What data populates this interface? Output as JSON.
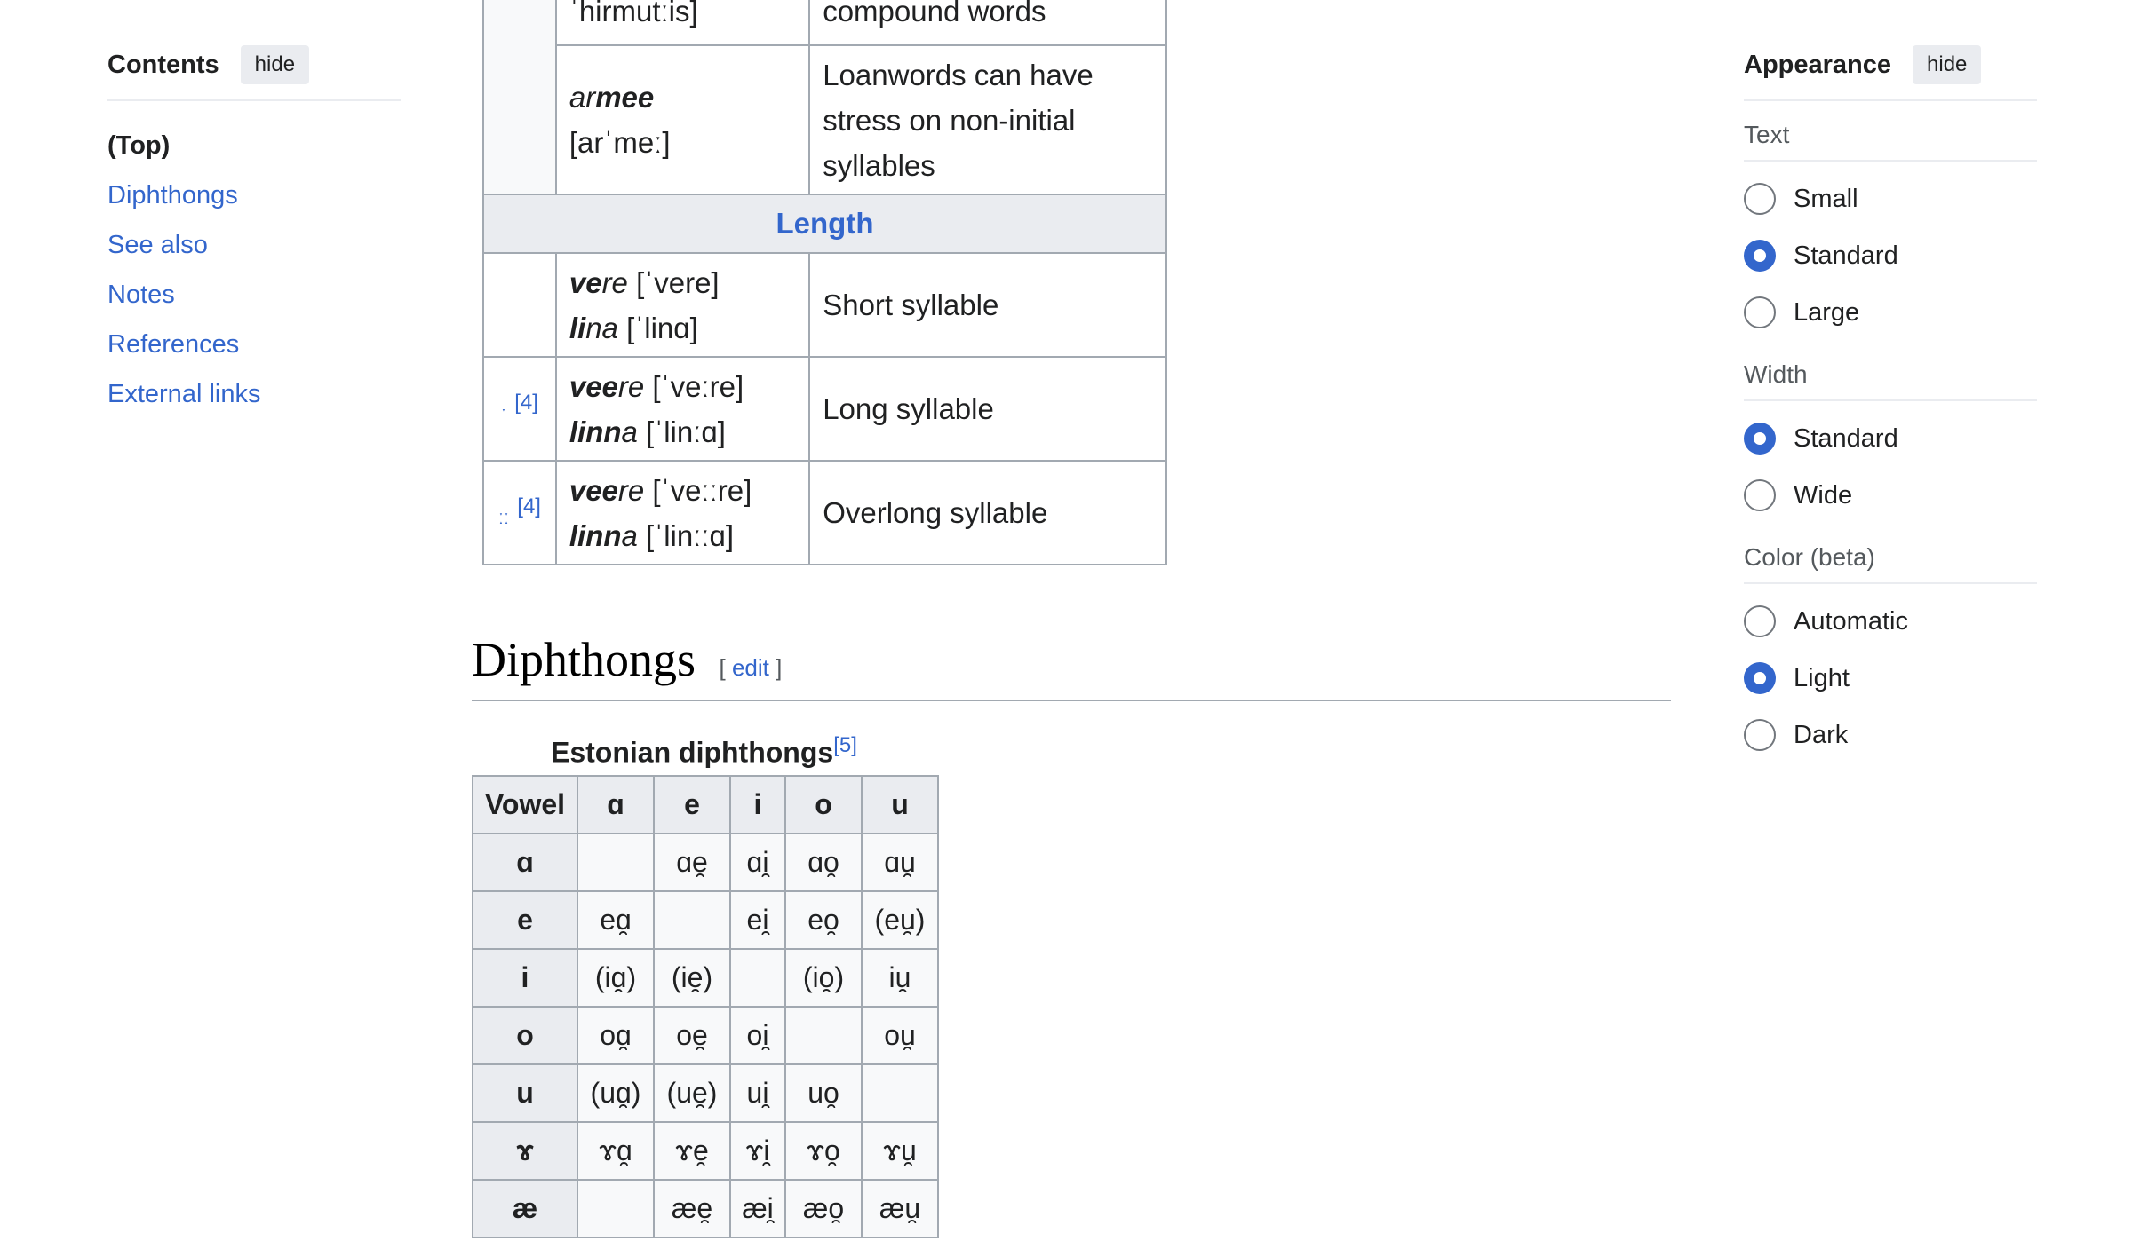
{
  "toc": {
    "title": "Contents",
    "hide_label": "hide",
    "items": [
      {
        "label": "(Top)"
      },
      {
        "label": "Diphthongs"
      },
      {
        "label": "See also"
      },
      {
        "label": "Notes"
      },
      {
        "label": "References"
      },
      {
        "label": "External links"
      }
    ]
  },
  "appearance": {
    "title": "Appearance",
    "hide_label": "hide",
    "text_group": {
      "label": "Text",
      "options": [
        "Small",
        "Standard",
        "Large"
      ],
      "selected": "Standard"
    },
    "width_group": {
      "label": "Width",
      "options": [
        "Standard",
        "Wide"
      ],
      "selected": "Standard"
    },
    "color_group": {
      "label": "Color (beta)",
      "options": [
        "Automatic",
        "Light",
        "Dark"
      ],
      "selected": "Light"
    },
    "accent_color": "#3366cc"
  },
  "stress_table": {
    "rows": {
      "r0": {
        "ipa": "[ˈherːneˈhirmutːis]",
        "desc": "compound words"
      },
      "r1": {
        "bold": "mee",
        "ital_pre": "ar",
        "ipa": "[arˈmeː]",
        "desc": "Loanwords can have stress on non-initial syllables"
      },
      "length_header": "Length",
      "short": {
        "w1_bold": "ve",
        "w1_rest": "re",
        "w1_ipa": "[ˈvere]",
        "w2_bold": "li",
        "w2_rest": "na",
        "w2_ipa": "[ˈlinɑ]",
        "desc": "Short syllable"
      },
      "long": {
        "mark": "ˑ",
        "ref": "[4]",
        "w1_bold": "vee",
        "w1_rest": "re",
        "w1_ipa": "[ˈveːre]",
        "w2_bold": "linn",
        "w2_rest": "a",
        "w2_ipa": "[ˈlinːɑ]",
        "desc": "Long syllable"
      },
      "overlong": {
        "mark": "ːː",
        "ref": "[4]",
        "w1_bold": "vee",
        "w1_rest": "re",
        "w1_ipa": "[ˈveːːre]",
        "w2_bold": "linn",
        "w2_rest": "a",
        "w2_ipa": "[ˈlinːːɑ]",
        "desc": "Overlong syllable"
      }
    }
  },
  "section": {
    "title": "Diphthongs",
    "edit_label": "edit",
    "bracket_open": "[",
    "bracket_close": "]"
  },
  "diphthongs": {
    "caption": "Estonian diphthongs",
    "caption_ref": "[5]",
    "header": [
      "Vowel",
      "ɑ",
      "e",
      "i",
      "o",
      "u"
    ],
    "rows": [
      [
        "ɑ",
        "",
        "ɑe̯",
        "ɑi̯",
        "ɑo̯",
        "ɑu̯"
      ],
      [
        "e",
        "eɑ̯",
        "",
        "ei̯",
        "eo̯",
        "(eu̯)"
      ],
      [
        "i",
        "(iɑ̯)",
        "(ie̯)",
        "",
        "(io̯)",
        "iu̯"
      ],
      [
        "o",
        "oɑ̯",
        "oe̯",
        "oi̯",
        "",
        "ou̯"
      ],
      [
        "u",
        "(uɑ̯)",
        "(ue̯)",
        "ui̯",
        "uo̯",
        ""
      ],
      [
        "ɤ",
        "ɤɑ̯",
        "ɤe̯",
        "ɤi̯",
        "ɤo̯",
        "ɤu̯"
      ],
      [
        "æ",
        "",
        "æe̯",
        "æi̯",
        "æo̯",
        "æu̯"
      ]
    ]
  }
}
